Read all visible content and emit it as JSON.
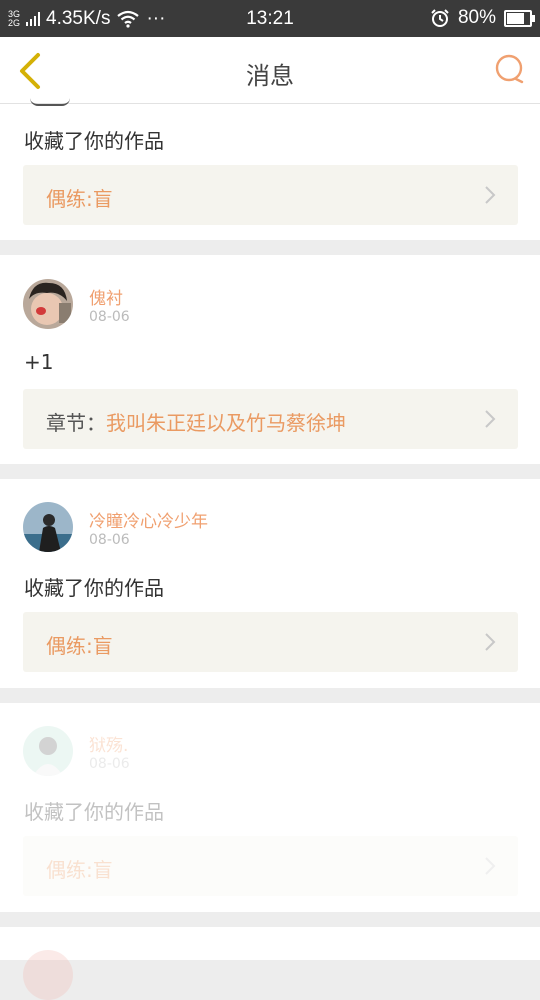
{
  "status_bar": {
    "network": [
      "3G",
      "2G"
    ],
    "speed": "4.35K/s",
    "dots": "···",
    "time": "13:21",
    "battery": "80%",
    "battery_level": 0.8
  },
  "header": {
    "title": "消息",
    "back_icon": "chevron-left-icon",
    "search_icon": "search-icon"
  },
  "messages": [
    {
      "text": "收藏了你的作品",
      "ref": {
        "value": "偶练:盲"
      }
    },
    {
      "user": "傀衬",
      "date": "08-06",
      "text": "+1",
      "ref": {
        "label": "章节：",
        "value": "我叫朱正廷以及竹马蔡徐坤"
      }
    },
    {
      "user": "冷瞳冷心冷少年",
      "date": "08-06",
      "text": "收藏了你的作品",
      "ref": {
        "value": "偶练:盲"
      }
    },
    {
      "user": "狱殇.",
      "date": "08-06",
      "text": "收藏了你的作品",
      "ref": {
        "value": "偶练:盲"
      }
    }
  ],
  "colors": {
    "accent": "#ea9a62",
    "username": "#f0a070",
    "back_icon": "#d4b106",
    "status_bar": "#3a3a3a"
  }
}
